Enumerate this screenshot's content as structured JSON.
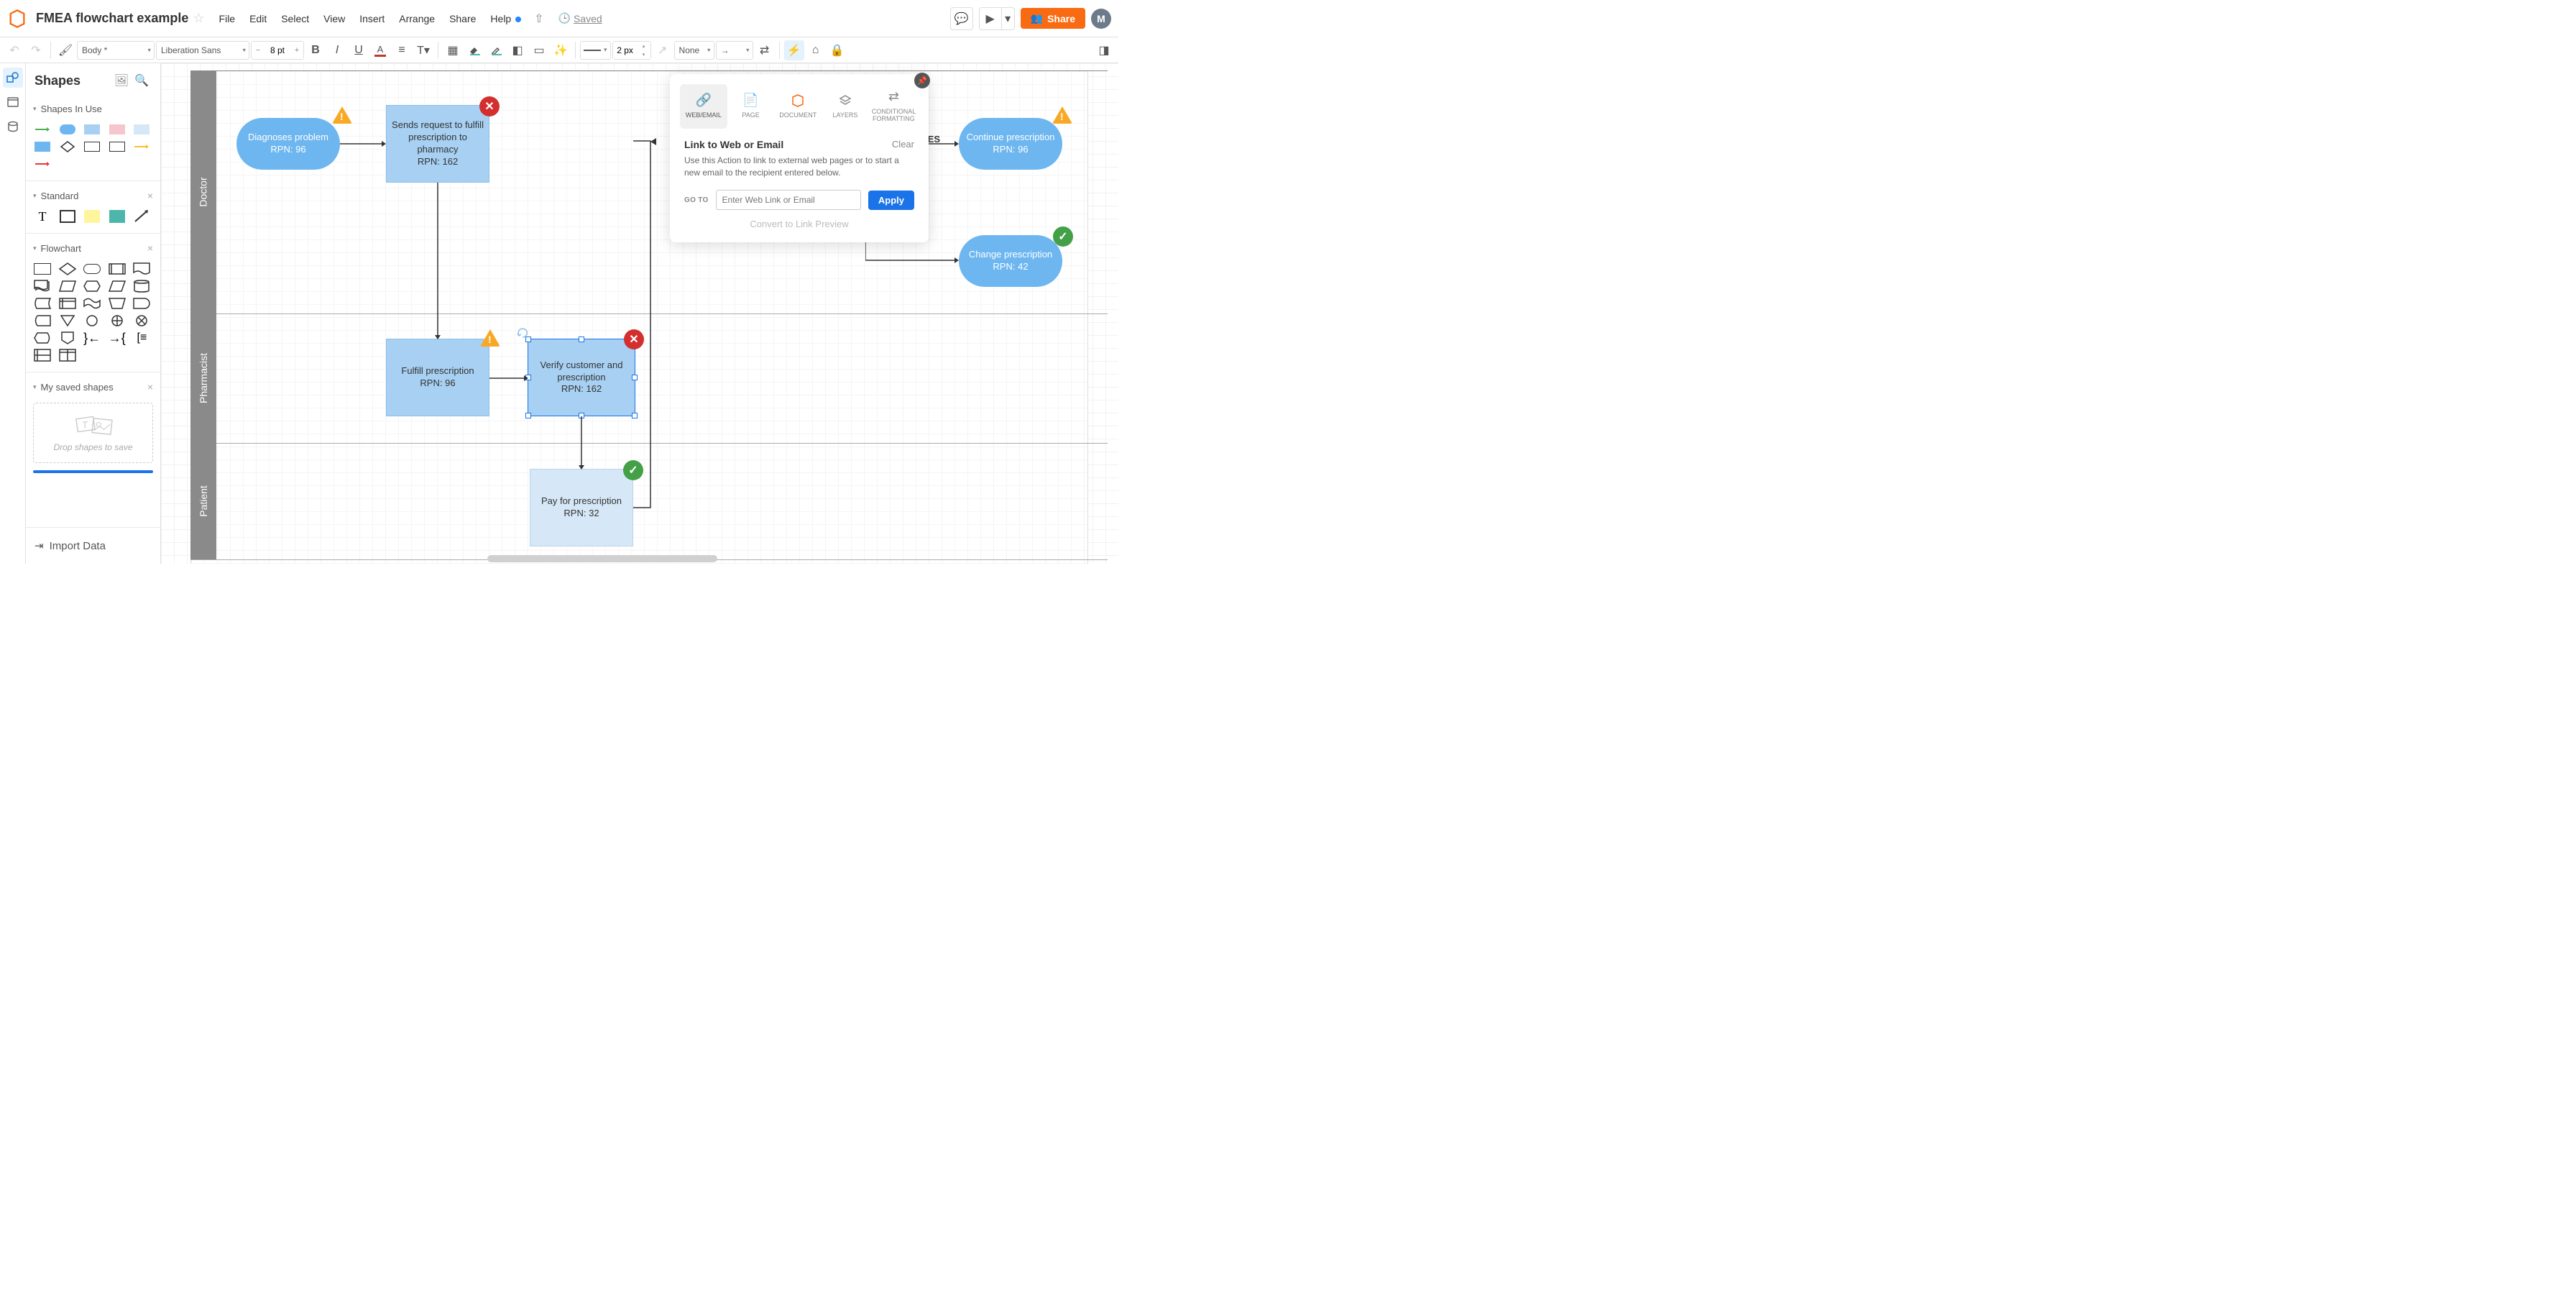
{
  "doc": {
    "title": "FMEA flowchart example",
    "saved": "Saved"
  },
  "menus": [
    "File",
    "Edit",
    "Select",
    "View",
    "Insert",
    "Arrange",
    "Share",
    "Help"
  ],
  "share": "Share",
  "avatar": "M",
  "toolbar": {
    "fontFamily": "Body *",
    "typeface": "Liberation Sans",
    "fontSize": "8 pt",
    "lineWidth": "2 px",
    "lineEnd": "None"
  },
  "shapes": {
    "title": "Shapes",
    "sections": {
      "inUse": "Shapes In Use",
      "standard": "Standard",
      "flowchart": "Flowchart",
      "mySaved": "My saved shapes"
    },
    "dropHint": "Drop shapes to save",
    "importData": "Import Data"
  },
  "swimlanes": [
    "Doctor",
    "Pharmacist",
    "Patient"
  ],
  "nodes": {
    "diagnose": "Diagnoses problem\nRPN: 96",
    "send": "Sends request to fulfill prescription to pharmacy\nRPN: 162",
    "fulfill": "Fulfill prescription\nRPN: 96",
    "verify": "Verify customer and prescription\nRPN: 162",
    "pay": "Pay for prescription\nRPN: 32",
    "continue": "Continue prescription\nRPN: 96",
    "change": "Change prescription\nRPN: 42",
    "yes": "YES"
  },
  "popover": {
    "tabs": {
      "web": "WEB/EMAIL",
      "page": "PAGE",
      "document": "DOCUMENT",
      "layers": "LAYERS",
      "cond": "CONDITIONAL FORMATTING"
    },
    "title": "Link to Web or Email",
    "clear": "Clear",
    "desc": "Use this Action to link to external web pages or to start a new email to the recipient entered below.",
    "gotoLabel": "GO TO",
    "placeholder": "Enter Web Link or Email",
    "apply": "Apply",
    "convert": "Convert to Link Preview"
  }
}
